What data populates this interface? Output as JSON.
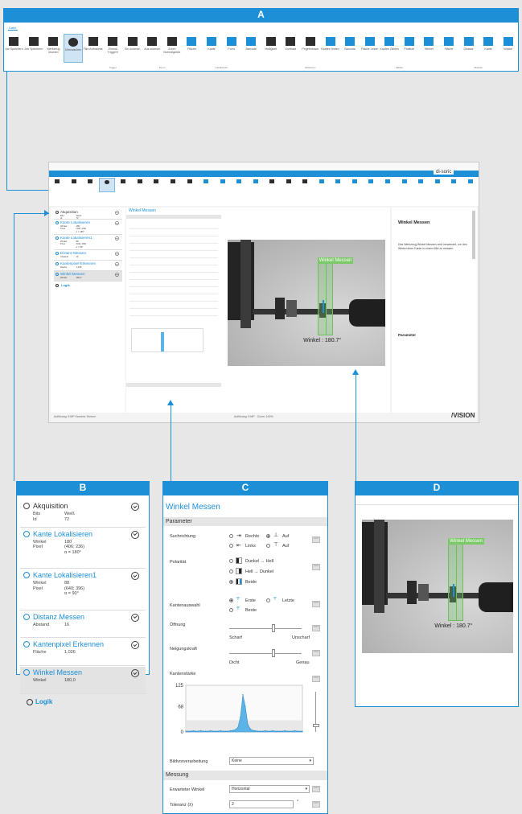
{
  "labels": {
    "a": "A",
    "b": "B",
    "c": "C",
    "d": "D"
  },
  "ribbon": {
    "tab": "Datei",
    "buttons": [
      "Job Speichern",
      "Job Speichern",
      "Werkzeug löschen",
      "Überwachen",
      "Film Aufnahme",
      "Einmal Triggern",
      "Ein-zoomen",
      "Aus-zoomen",
      "Zoom Normalgröße",
      "Fläche",
      "Kante",
      "Form",
      "Barcode",
      "Helligkeit",
      "Kontrast",
      "Pegelmesser",
      "Kanten finden",
      "Barcode",
      "Fläche Lesen",
      "Kanten Zählen",
      "Position",
      "Winkel",
      "Fläche",
      "Distanz",
      "Kante",
      "Winkel"
    ],
    "groups": [
      "Trigger",
      "Zoom",
      "Lokalisieren",
      "Erkennen",
      "Zählen",
      "Messen"
    ]
  },
  "app": {
    "title": "di-soric",
    "brand": "/VISION",
    "status": "Auflösung: 5 MP  ·  Zoom: 100%",
    "footer_left": "Auflösung: 5 MP  Kamera: Sensor"
  },
  "steps": [
    {
      "title": "Akquisition",
      "rows": [
        [
          "Bits",
          "Weiß"
        ],
        [
          "Id",
          "72"
        ]
      ]
    },
    {
      "title": "Kante Lokalisieren",
      "rows": [
        [
          "Winkel",
          "180"
        ],
        [
          "Pixel",
          "(406; 236)"
        ],
        [
          "",
          "α = 180°"
        ]
      ]
    },
    {
      "title": "Kante Lokalisieren1",
      "rows": [
        [
          "Winkel",
          "88"
        ],
        [
          "Pixel",
          "(640; 396)"
        ],
        [
          "",
          "α = 90°"
        ]
      ]
    },
    {
      "title": "Distanz Messen",
      "rows": [
        [
          "Abstand",
          "16"
        ]
      ]
    },
    {
      "title": "Kantenpixel Erkennen",
      "rows": [
        [
          "Fläche",
          "1,026"
        ]
      ]
    },
    {
      "title": "Winkel Messen",
      "rows": [
        [
          "Winkel",
          "180,0"
        ]
      ]
    }
  ],
  "steps_footer": "Logik",
  "param": {
    "title": "Winkel Messen",
    "section1": "Parameter",
    "suchrichtung": {
      "label": "Suchrichtung",
      "opts": [
        "Rechts",
        "Auf",
        "Links",
        "Auf"
      ]
    },
    "polaritaet": {
      "label": "Polarität",
      "opts": [
        "Dunkel → Hell",
        "Hell → Dunkel",
        "Beide"
      ]
    },
    "kantenauswahl": {
      "label": "Kantenauswahl",
      "opts": [
        "Erste",
        "Letzte",
        "Beste"
      ]
    },
    "oeffnung": {
      "label": "Öffnung",
      "min": "Scharf",
      "max": "Unscharf"
    },
    "neigung": {
      "label": "Neigungskraft",
      "min": "Dicht",
      "max": "Genau"
    },
    "kantenstaerke": {
      "label": "Kantenstärke"
    },
    "bildvorverarbeitung": {
      "label": "Bildvorverarbeitung",
      "value": "Keine"
    },
    "section2": "Messung",
    "winkel": {
      "label": "Erwarteter Winkel",
      "value": "Horizontal"
    },
    "toleranz": {
      "label": "Toleranz (±)",
      "value": "2",
      "unit": "°"
    }
  },
  "chart_data": {
    "type": "area",
    "ylim": [
      0,
      125
    ],
    "yticks": [
      "125",
      "68",
      "0"
    ],
    "values": [
      2,
      2,
      2,
      3,
      2,
      2,
      3,
      2,
      2,
      2,
      3,
      2,
      2,
      2,
      3,
      2,
      2,
      2,
      3,
      4,
      6,
      12,
      40,
      100,
      68,
      20,
      8,
      4,
      3,
      2,
      2,
      2,
      3,
      2,
      2,
      3,
      2,
      2,
      2,
      2,
      3,
      2,
      2,
      2,
      3,
      2,
      2,
      2
    ],
    "color": "#5bb4e5"
  },
  "image": {
    "overlay_label": "Winkel Messen",
    "result": "Winkel : 180.7°"
  },
  "help": {
    "title": "Winkel Messen",
    "body": "Das Werkzeug Winkel Messen wird verwendet, um den Winkel einer Kante in einem Bild zu messen.",
    "section": "Parameter"
  }
}
